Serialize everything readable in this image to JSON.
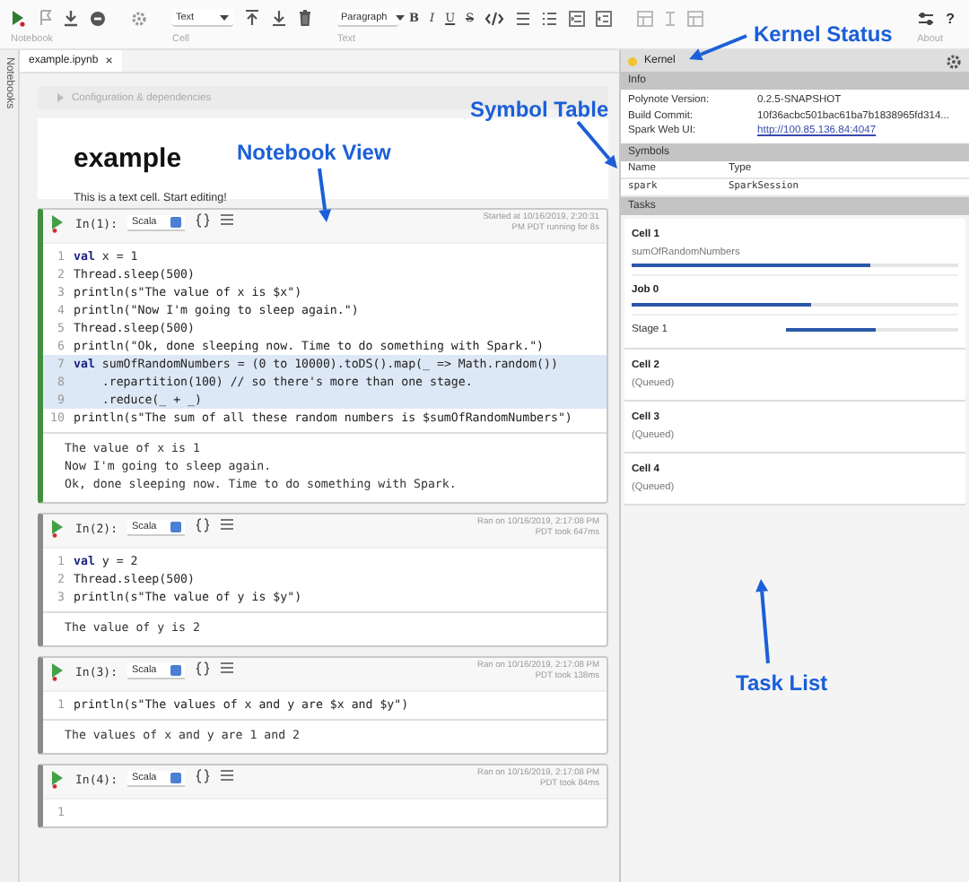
{
  "toolbar": {
    "groups": [
      {
        "kind": "notebook",
        "label": "Notebook"
      },
      {
        "kind": "cell",
        "label": "Cell",
        "dropdown": "Text"
      },
      {
        "kind": "text",
        "label": "Text",
        "dropdown": "Paragraph",
        "format_buttons": [
          "B",
          "I",
          "U",
          "S"
        ]
      },
      {
        "kind": "table"
      },
      {
        "kind": "about",
        "label": "About",
        "help": "?"
      }
    ]
  },
  "sidebar": {
    "label": "Notebooks"
  },
  "tabs": [
    {
      "label": "example.ipynb",
      "close": "×",
      "selected": true
    }
  ],
  "notebook": {
    "config": {
      "label": "Configuration & dependencies",
      "expanded": false
    },
    "text_cell": {
      "heading": "example",
      "body": "This is a text cell. Start editing!"
    },
    "cells": [
      {
        "prompt": "In(1):",
        "language": "Scala",
        "status": "Started at 10/16/2019, 2:20:31 PM PDT running for 8s",
        "selected": true,
        "lines": [
          {
            "number": "1",
            "code": "**val** x = 1",
            "highlighted": false
          },
          {
            "number": "2",
            "code": "Thread.sleep(500)",
            "highlighted": false
          },
          {
            "number": "3",
            "code": "println(s\"The value of x is $x\")",
            "highlighted": false
          },
          {
            "number": "4",
            "code": "println(\"Now I'm going to sleep again.\")",
            "highlighted": false
          },
          {
            "number": "5",
            "code": "Thread.sleep(500)",
            "highlighted": false
          },
          {
            "number": "6",
            "code": "println(\"Ok, done sleeping now. Time to do something with Spark.\")",
            "highlighted": false
          },
          {
            "number": "7",
            "code": "**val** sumOfRandomNumbers = (0 to 10000).toDS().map(_ => Math.random())",
            "highlighted": true
          },
          {
            "number": "8",
            "code": "    .repartition(100) // so there's more than one stage.",
            "highlighted": true
          },
          {
            "number": "9",
            "code": "    .reduce(_ + _)",
            "highlighted": true
          },
          {
            "number": "10",
            "code": "println(s\"The sum of all these random numbers is $sumOfRandomNumbers\")",
            "highlighted": false
          }
        ],
        "output": [
          "The value of x is 1",
          "Now I'm going to sleep again.",
          "Ok, done sleeping now. Time to do something with Spark."
        ]
      },
      {
        "prompt": "In(2):",
        "language": "Scala",
        "status": "Ran on 10/16/2019, 2:17:08 PM PDT took 647ms",
        "selected": false,
        "lines": [
          {
            "number": "1",
            "code": "**val** y = 2",
            "highlighted": false
          },
          {
            "number": "2",
            "code": "Thread.sleep(500)",
            "highlighted": false
          },
          {
            "number": "3",
            "code": "println(s\"The value of y is $y\")",
            "highlighted": false
          }
        ],
        "output": [
          "The value of y is 2"
        ]
      },
      {
        "prompt": "In(3):",
        "language": "Scala",
        "status": "Ran on 10/16/2019, 2:17:08 PM PDT took 138ms",
        "selected": false,
        "lines": [
          {
            "number": "1",
            "code": "println(s\"The values of x and y are $x and $y\")",
            "highlighted": false
          }
        ],
        "output": [
          "The values of x and y are 1 and 2"
        ]
      },
      {
        "prompt": "In(4):",
        "language": "Scala",
        "status": "Ran on 10/16/2019, 2:17:08 PM PDT took 84ms",
        "selected": false,
        "lines": [
          {
            "number": "1",
            "highlighted": false
          }
        ]
      }
    ]
  },
  "kernel": {
    "title": "Kernel",
    "busy": true
  },
  "info": {
    "title": "Info",
    "rows": [
      {
        "key": "Polynote Version:",
        "value": "0.2.5-SNAPSHOT",
        "kind": "text"
      },
      {
        "key": "Build Commit:",
        "value": "10f36acbc501bac61ba7b1838965fd314...",
        "kind": "text"
      },
      {
        "key": "Spark Web UI:",
        "value": "http://100.85.136.84:4047",
        "kind": "link"
      }
    ]
  },
  "symbols": {
    "title": "Symbols",
    "columns": [
      "Name",
      "Type"
    ],
    "rows": [
      [
        "spark",
        "SparkSession"
      ]
    ]
  },
  "tasks": {
    "title": "Tasks",
    "items": [
      {
        "title": "Cell 1",
        "detail": "sumOfRandomNumbers",
        "level": 0.73,
        "children": [
          {
            "title": "Job 0",
            "level": 0.55,
            "children": [
              {
                "title": "Stage 1",
                "level": 0.52
              }
            ]
          }
        ]
      },
      {
        "title": "Cell 2",
        "detail": "(Queued)"
      },
      {
        "title": "Cell 3",
        "detail": "(Queued)"
      },
      {
        "title": "Cell 4",
        "detail": "(Queued)"
      }
    ]
  },
  "annotations": [
    {
      "text": "Kernel Status"
    },
    {
      "text": "Symbol Table"
    },
    {
      "text": "Notebook View"
    },
    {
      "text": "Task List"
    }
  ]
}
